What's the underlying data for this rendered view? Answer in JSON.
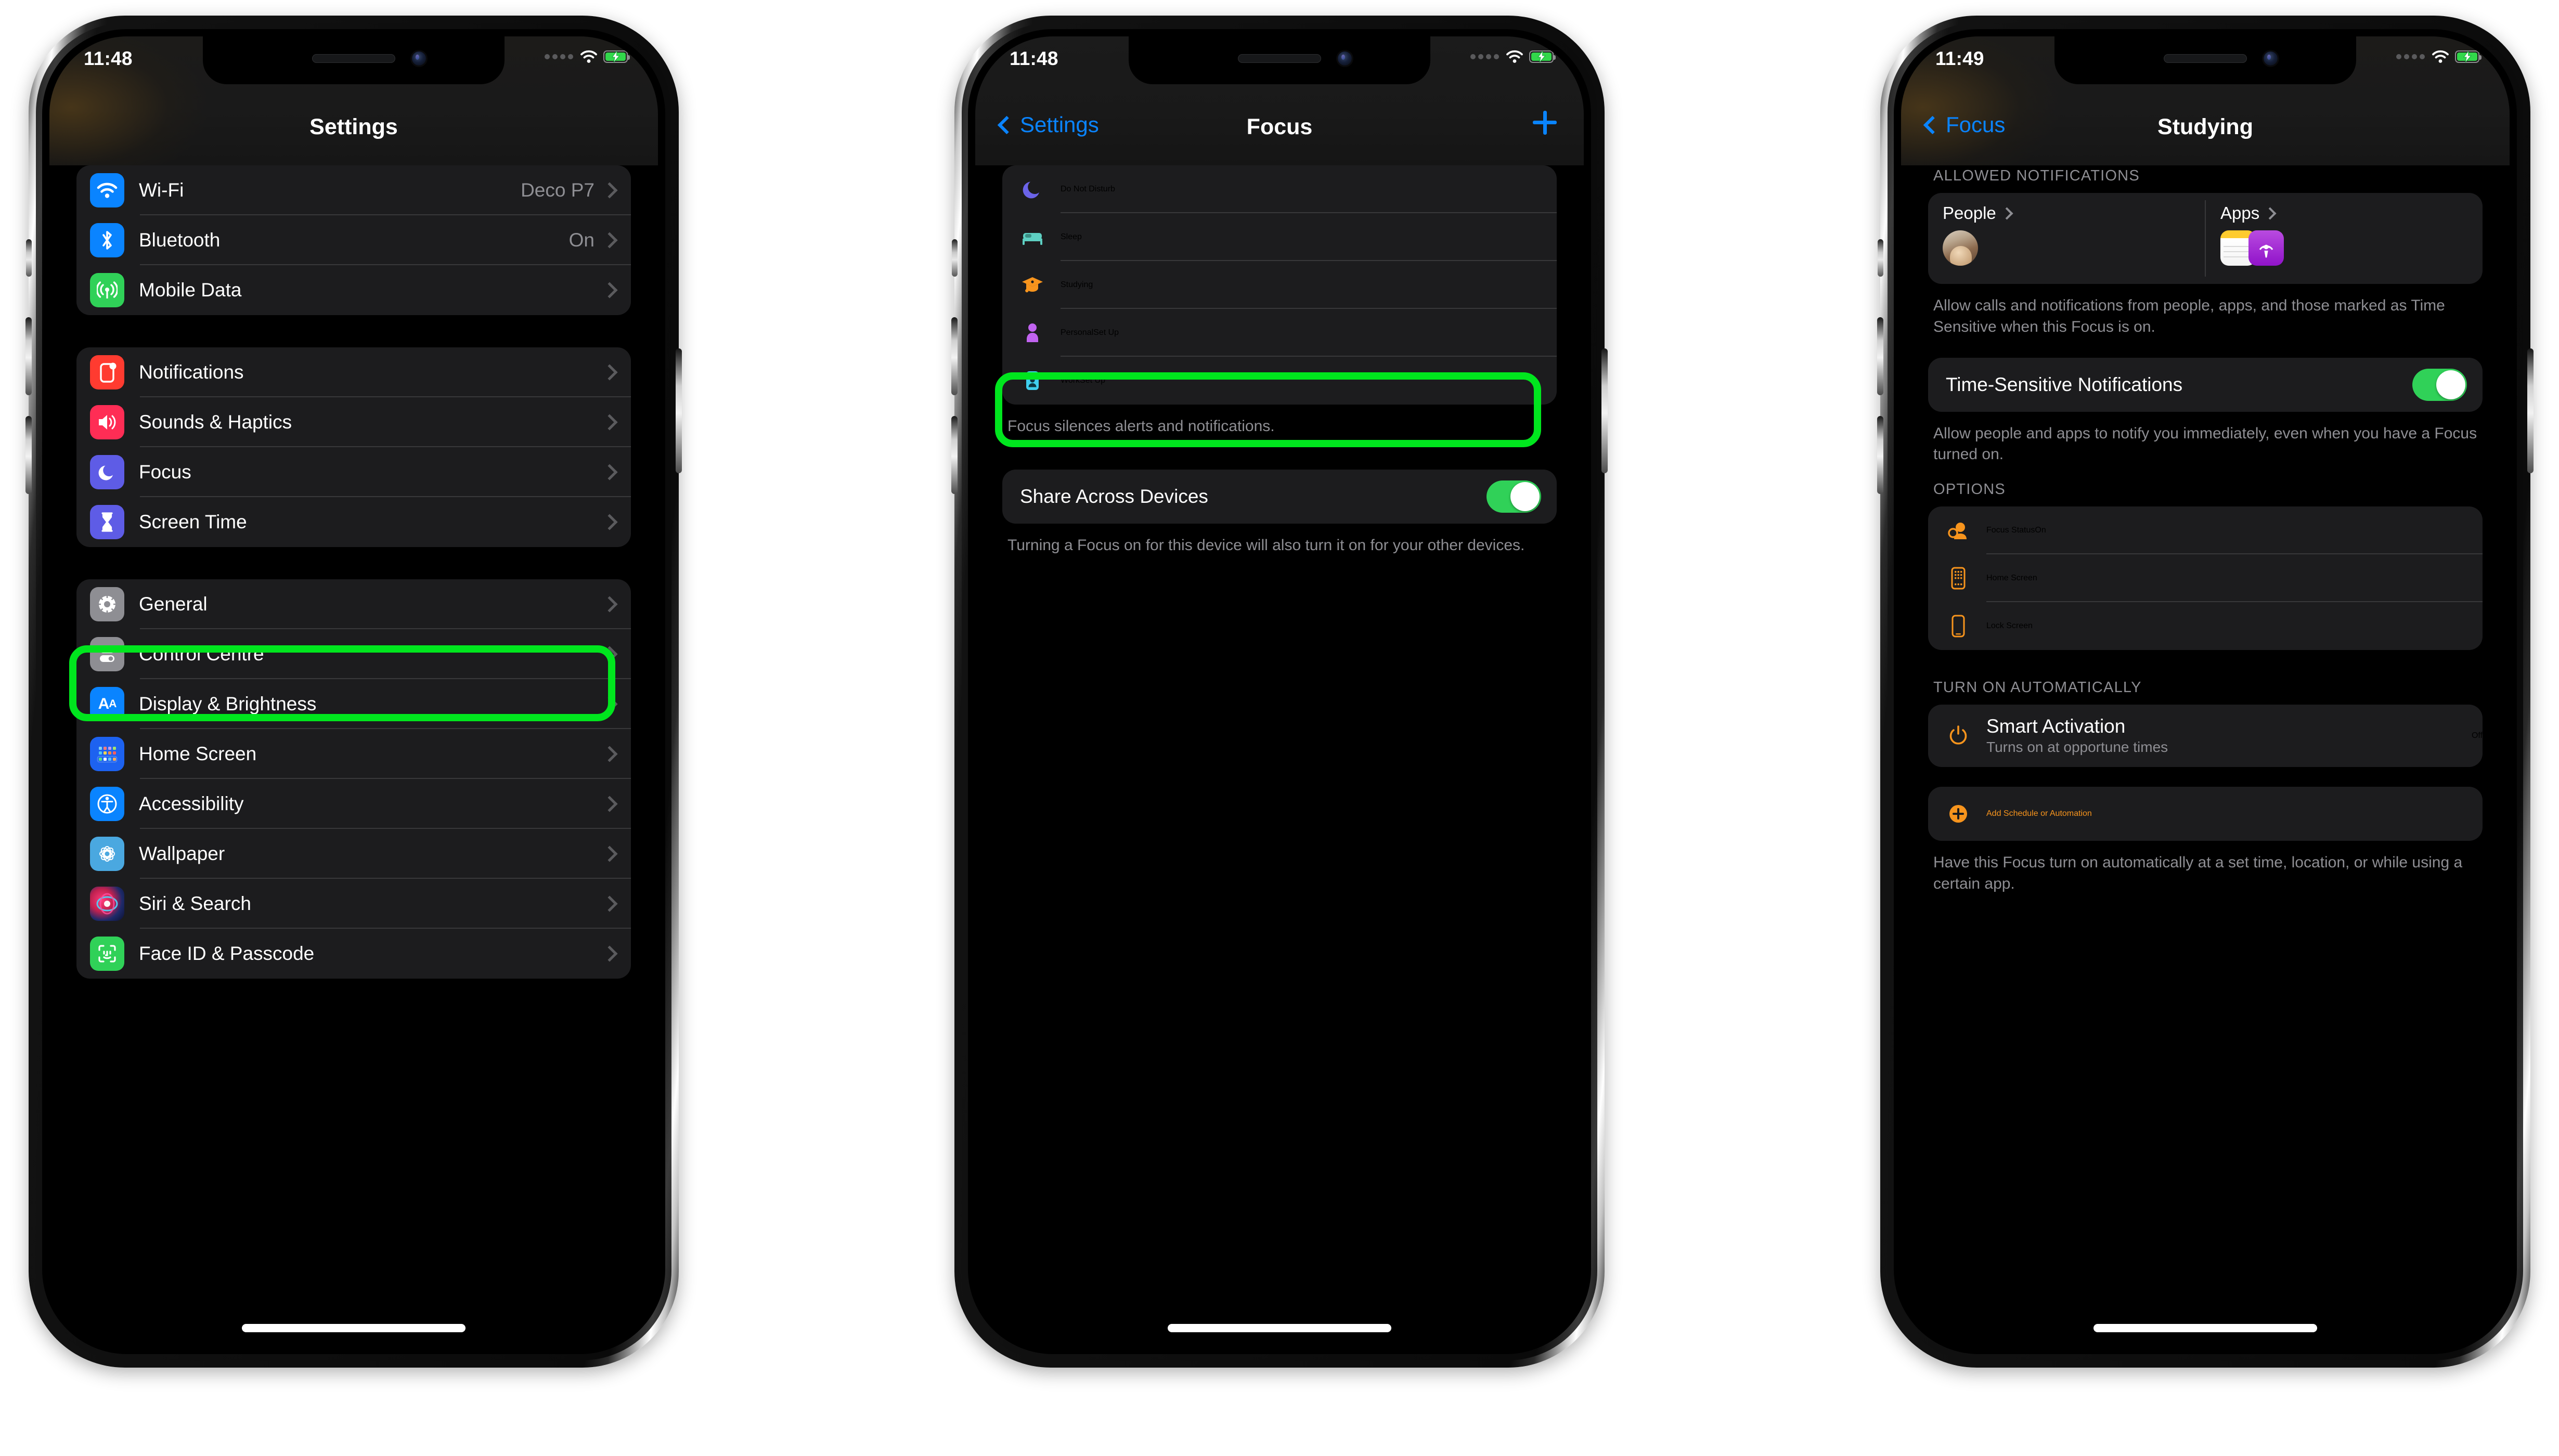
{
  "colors": {
    "highlight": "#00e61e",
    "accent_blue": "#0a84ff",
    "accent_orange": "#ff9f0a",
    "toggle_on": "#30d158",
    "card": "#1c1c1e",
    "secondary_text": "#8e8e93"
  },
  "phone1": {
    "status": {
      "time": "11:48",
      "wifi": "wifi-icon",
      "battery": "battery-charging-icon",
      "signal": "signal-dots-icon"
    },
    "nav": {
      "title": "Settings"
    },
    "groups": [
      {
        "rows": [
          {
            "label": "Wi-Fi",
            "value": "Deco P7",
            "icon": "wifi-icon",
            "icon_bg": "#0a84ff",
            "chevron": true
          },
          {
            "label": "Bluetooth",
            "value": "On",
            "icon": "bluetooth-icon",
            "icon_bg": "#0a84ff",
            "chevron": true
          },
          {
            "label": "Mobile Data",
            "value": "",
            "icon": "cellular-icon",
            "icon_bg": "#30d158",
            "chevron": true
          }
        ]
      },
      {
        "rows": [
          {
            "label": "Notifications",
            "value": "",
            "icon": "notifications-icon",
            "icon_bg": "#ff3b30",
            "chevron": true
          },
          {
            "label": "Sounds & Haptics",
            "value": "",
            "icon": "speaker-icon",
            "icon_bg": "#ff2d55",
            "chevron": true
          },
          {
            "label": "Focus",
            "value": "",
            "icon": "moon-icon",
            "icon_bg": "#5e5ce6",
            "chevron": true,
            "highlighted": true
          },
          {
            "label": "Screen Time",
            "value": "",
            "icon": "hourglass-icon",
            "icon_bg": "#5e5ce6",
            "chevron": true
          }
        ]
      },
      {
        "rows": [
          {
            "label": "General",
            "value": "",
            "icon": "gear-icon",
            "icon_bg": "#8e8e93",
            "chevron": true
          },
          {
            "label": "Control Centre",
            "value": "",
            "icon": "control-centre-icon",
            "icon_bg": "#8e8e93",
            "chevron": true
          },
          {
            "label": "Display & Brightness",
            "value": "",
            "icon": "display-brightness-icon",
            "icon_bg": "#0a84ff",
            "chevron": true
          },
          {
            "label": "Home Screen",
            "value": "",
            "icon": "home-screen-icon",
            "icon_bg": "#1d62f0",
            "chevron": true
          },
          {
            "label": "Accessibility",
            "value": "",
            "icon": "accessibility-icon",
            "icon_bg": "#0a84ff",
            "chevron": true
          },
          {
            "label": "Wallpaper",
            "value": "",
            "icon": "wallpaper-icon",
            "icon_bg": "#4aa8e0",
            "chevron": true
          },
          {
            "label": "Siri & Search",
            "value": "",
            "icon": "siri-icon",
            "icon_bg": "#2b2b2f",
            "chevron": true
          },
          {
            "label": "Face ID & Passcode",
            "value": "",
            "icon": "face-id-icon",
            "icon_bg": "#30d158",
            "chevron": true
          }
        ]
      }
    ]
  },
  "phone2": {
    "status": {
      "time": "11:48"
    },
    "nav": {
      "back": "Settings",
      "title": "Focus",
      "add": "add-focus-button"
    },
    "focus_list": [
      {
        "label": "Do Not Disturb",
        "value": "",
        "icon": "moon-glyph-icon"
      },
      {
        "label": "Sleep",
        "value": "",
        "icon": "bed-glyph-icon"
      },
      {
        "label": "Studying",
        "value": "",
        "icon": "graduation-cap-glyph-icon",
        "highlighted": true
      },
      {
        "label": "Personal",
        "value": "Set Up",
        "icon": "person-glyph-icon"
      },
      {
        "label": "Work",
        "value": "Set Up",
        "icon": "badge-glyph-icon"
      }
    ],
    "focus_footnote": "Focus silences alerts and notifications.",
    "share": {
      "label": "Share Across Devices",
      "toggle": "on"
    },
    "share_footnote": "Turning a Focus on for this device will also turn it on for your other devices."
  },
  "phone3": {
    "status": {
      "time": "11:49"
    },
    "nav": {
      "back": "Focus",
      "title": "Studying"
    },
    "allowed_header": "ALLOWED NOTIFICATIONS",
    "allowed": {
      "people_label": "People",
      "apps_label": "Apps",
      "people_avatars": [
        "contact-avatar"
      ],
      "app_icons": [
        "notes-app-icon",
        "podcasts-app-icon"
      ]
    },
    "allowed_footnote": "Allow calls and notifications from people, apps, and those marked as Time Sensitive when this Focus is on.",
    "time_sensitive": {
      "label": "Time-Sensitive Notifications",
      "toggle": "on"
    },
    "time_sensitive_footnote": "Allow people and apps to notify you immediately, even when you have a Focus turned on.",
    "options_header": "OPTIONS",
    "options": [
      {
        "label": "Focus Status",
        "value": "On",
        "icon": "focus-status-icon"
      },
      {
        "label": "Home Screen",
        "value": "",
        "icon": "home-screen-outline-icon"
      },
      {
        "label": "Lock Screen",
        "value": "",
        "icon": "lock-screen-outline-icon"
      }
    ],
    "auto_header": "TURN ON AUTOMATICALLY",
    "smart_activation": {
      "label": "Smart Activation",
      "sub": "Turns on at opportune times",
      "value": "Off",
      "icon": "power-icon"
    },
    "add_schedule": {
      "label": "Add Schedule or Automation",
      "icon": "plus-circle-icon"
    },
    "auto_footnote": "Have this Focus turn on automatically at a set time, location, or while using a certain app."
  }
}
